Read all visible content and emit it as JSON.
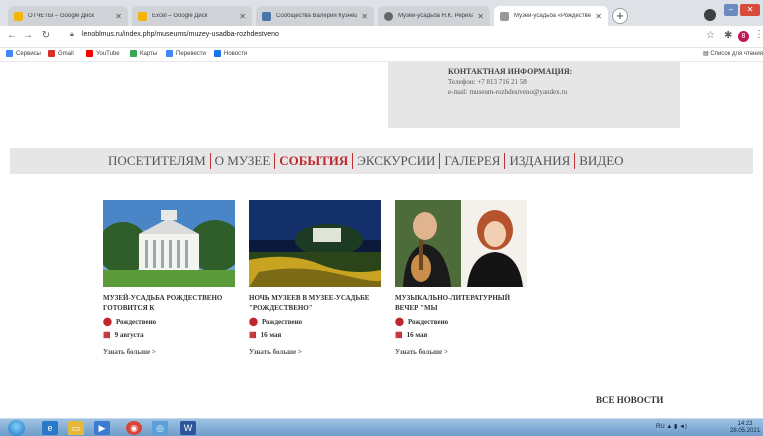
{
  "browser": {
    "tabs": [
      {
        "title": "ОТЧЕТЫ – Google Диск",
        "icon_color": "#f4b400"
      },
      {
        "title": "Excel – Google Диск",
        "icon_color": "#f4b400"
      },
      {
        "title": "Сообщества Валерии Кузнецо",
        "icon_color": "#4a76a8"
      },
      {
        "title": "Музей-усадьба Н.К. Рериха в Из",
        "icon_color": "#666666"
      },
      {
        "title": "Музей-усадьба «Рождествено»",
        "icon_color": "#999999"
      }
    ],
    "new_tab": "+",
    "url": "lenoblmus.ru/index.php/museums/muzey-usadba-rozhdestveno",
    "bookmarks": [
      {
        "label": "Сервисы",
        "icon_color": "#4285f4"
      },
      {
        "label": "Gmail",
        "icon_color": "#d93025"
      },
      {
        "label": "YouTube",
        "icon_color": "#ff0000"
      },
      {
        "label": "Карты",
        "icon_color": "#34a853"
      },
      {
        "label": "Перевести",
        "icon_color": "#4285f4"
      },
      {
        "label": "Новости",
        "icon_color": "#1a73e8"
      }
    ],
    "reading_list": "Список для чтения",
    "profile_letter": "8"
  },
  "contact": {
    "title": "КОНТАКТНАЯ ИНФОРМАЦИЯ:",
    "phone": "Телефон: +7 813 716 21 58",
    "email": "e-mail: museum-rozhdestveno@yandex.ru"
  },
  "nav": {
    "items": [
      "ПОСЕТИТЕЛЯМ",
      "О МУЗЕЕ",
      "СОБЫТИЯ",
      "ЭКСКУРСИИ",
      "ГАЛЕРЕЯ",
      "ИЗДАНИЯ",
      "ВИДЕО"
    ],
    "active": "СОБЫТИЯ"
  },
  "cards": [
    {
      "title": "МУЗЕЙ-УСАДЬБА РОЖДЕСТВЕНО ГОТОВИТСЯ К",
      "place": "Рождествено",
      "date": "9 августа",
      "more": "Узнать больше >"
    },
    {
      "title": "НОЧЬ МУЗЕЕВ В МУЗЕЕ-УСАДЬБЕ \"РОЖДЕСТВЕНО\"",
      "place": "Рождествено",
      "date": "16 мая",
      "more": "Узнать больше >"
    },
    {
      "title": "МУЗЫКАЛЬНО-ЛИТЕРАТУРНЫЙ ВЕЧЕР \"МЫ",
      "place": "Рождествено",
      "date": "16 мая",
      "more": "Узнать больше >"
    }
  ],
  "all_news": "ВСЕ НОВОСТИ",
  "taskbar": {
    "lang": "RU",
    "time": "14:23",
    "date": "28.05.2021"
  },
  "colors": {
    "accent_red": "#c0272d",
    "band_gray": "#e6e6e6"
  }
}
